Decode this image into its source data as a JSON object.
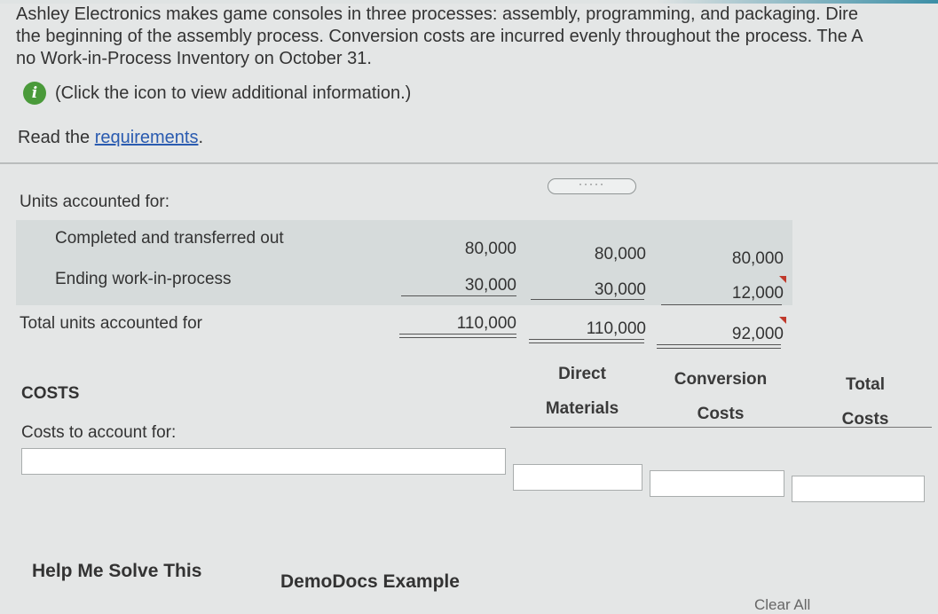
{
  "intro": {
    "line1": "Ashley Electronics makes game consoles in three processes: assembly, programming, and packaging. Dire",
    "line2": "the beginning of the assembly process. Conversion costs are incurred evenly throughout the process. The A",
    "line3": "no Work-in-Process Inventory on October 31."
  },
  "info": {
    "icon_glyph": "i",
    "text": "(Click the icon to view additional information.)"
  },
  "requirements": {
    "prefix": "Read the ",
    "link": "requirements",
    "suffix": "."
  },
  "expand_button": "·····",
  "units": {
    "section_label": "Units accounted for:",
    "rows": [
      {
        "label": "Completed and transferred out",
        "physical": "80,000",
        "direct_materials": "80,000",
        "conversion": "80,000"
      },
      {
        "label": "Ending work-in-process",
        "physical": "30,000",
        "direct_materials": "30,000",
        "conversion": "12,000"
      }
    ],
    "total": {
      "label": "Total units accounted for",
      "physical": "110,000",
      "direct_materials": "110,000",
      "conversion": "92,000"
    }
  },
  "costs": {
    "title": "COSTS",
    "section_label": "Costs to account for:",
    "headers": {
      "direct_materials": [
        "Direct",
        "Materials"
      ],
      "conversion": [
        "Conversion",
        "Costs"
      ],
      "total": [
        "Total",
        "Costs"
      ]
    }
  },
  "footer": {
    "help": "Help Me Solve This",
    "demo": "DemoDocs Example",
    "clear": "Clear All"
  },
  "colors": {
    "info_icon": "#4a9a3a",
    "link": "#2a5bb0",
    "incorrect_marker": "#c0392b"
  }
}
